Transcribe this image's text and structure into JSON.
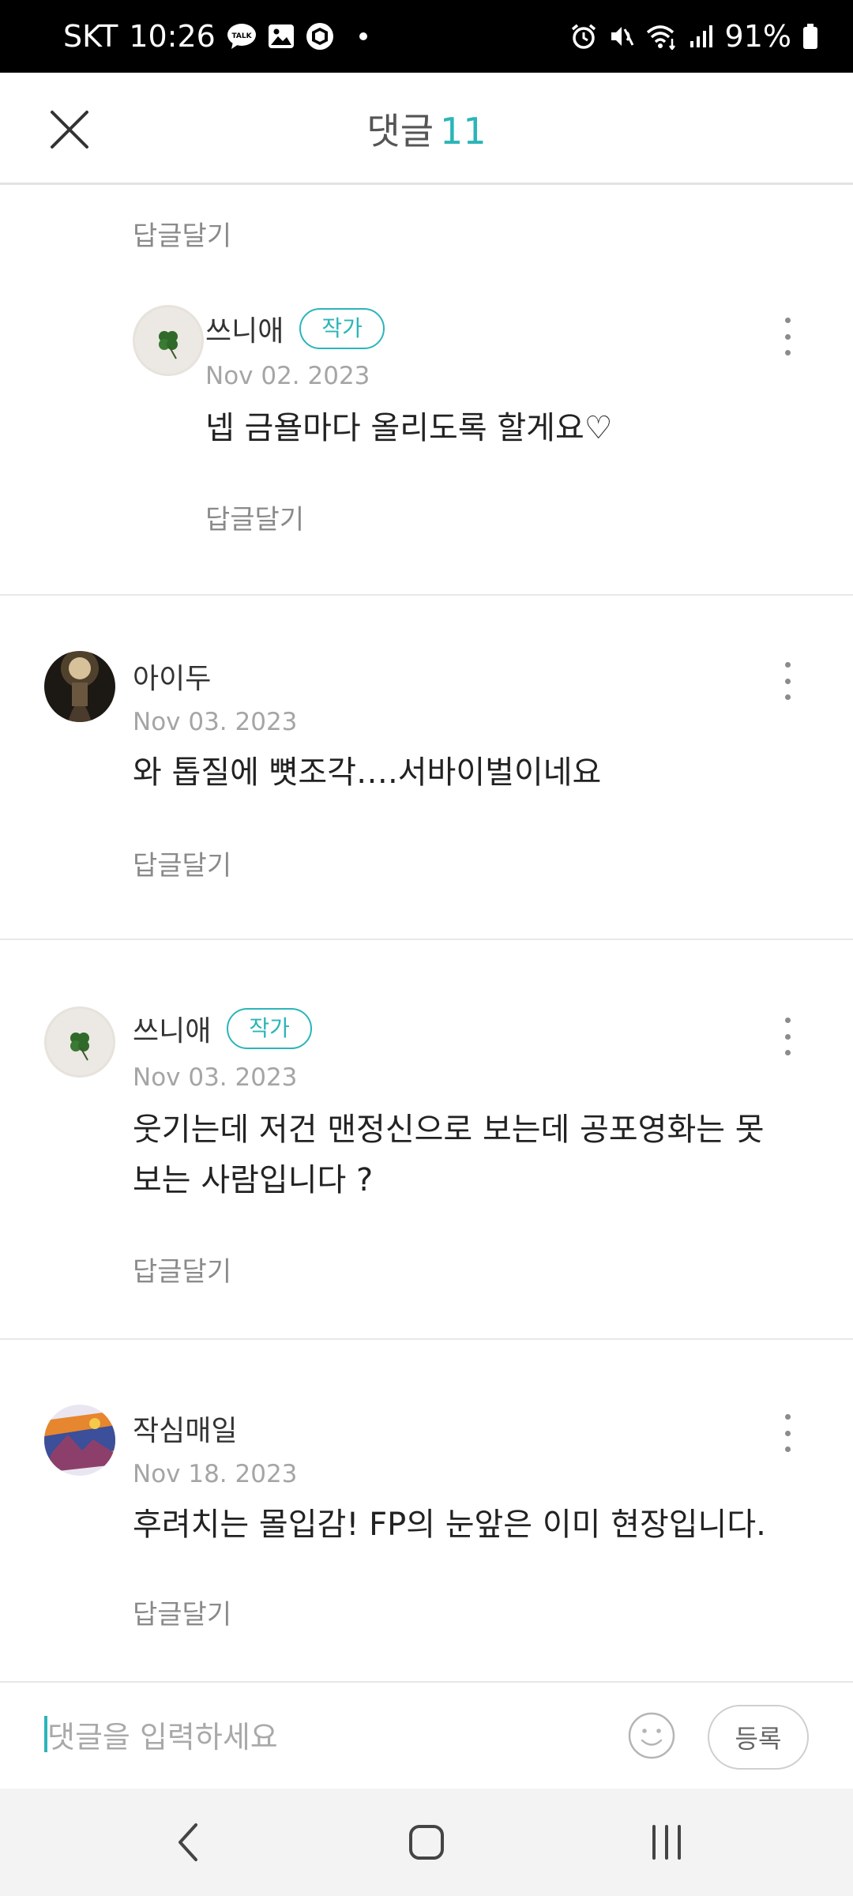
{
  "status_bar": {
    "carrier": "SKT",
    "time": "10:26",
    "battery": "91%",
    "left_icons": [
      "talk-icon",
      "gallery-icon",
      "box-icon",
      "dot-icon"
    ],
    "right_icons": [
      "alarm-icon",
      "mute-icon",
      "wifi-icon",
      "signal-icon",
      "battery-icon"
    ]
  },
  "header": {
    "title": "댓글",
    "count": "11"
  },
  "comments": [
    {
      "reply_label": "답글달기"
    },
    {
      "author": "쓰니애",
      "badge": "작가",
      "date": "Nov 02. 2023",
      "text": "넵 금욜마다 올리도록 할게요♡",
      "reply_label": "답글달기"
    },
    {
      "author": "아이두",
      "date": "Nov 03. 2023",
      "text": "와 톱질에 뼛조각….서바이벌이네요",
      "reply_label": "답글달기"
    },
    {
      "author": "쓰니애",
      "badge": "작가",
      "date": "Nov 03. 2023",
      "text_line1": "웃기는데 저건 맨정신으로 보는데 공포영화는 못",
      "text_line2": "보는 사람입니다 ?",
      "reply_label": "답글달기"
    },
    {
      "author": "작심매일",
      "date": "Nov 18. 2023",
      "text": "후려치는 몰입감! FP의 눈앞은 이미 현장입니다.",
      "reply_label": "답글달기"
    }
  ],
  "input": {
    "placeholder": "댓글을 입력하세요",
    "submit_label": "등록"
  },
  "colors": {
    "accent": "#2bb5b8",
    "muted": "#8a8a8a"
  }
}
